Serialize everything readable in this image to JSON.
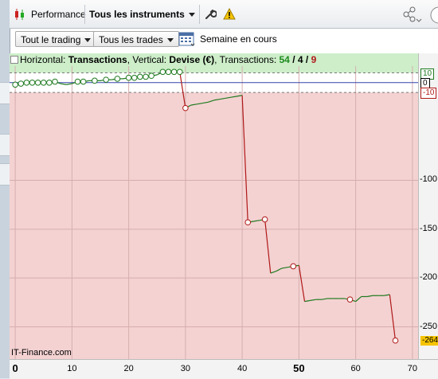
{
  "titlebar": {
    "performance_label": "Performance",
    "instruments_label": "Tous les instruments"
  },
  "toolbar": {
    "trading_label": "Tout le trading",
    "trades_label": "Tous les trades",
    "week_label": "Semaine en cours"
  },
  "infobar": {
    "horizontal_prefix": "Horizontal: ",
    "horizontal_value": "Transactions",
    "vertical_prefix": ", Vertical: ",
    "vertical_value": "Devise (€)",
    "count_prefix": ", Transactions: ",
    "count_total": "54",
    "sep1": " / ",
    "count_win": "4",
    "sep2": " / ",
    "count_loss": "9"
  },
  "watermark": "IT-Finance.com",
  "colors": {
    "profit_zone": "#cdeec9",
    "loss_zone": "#f4d2d2",
    "win_line": "#1e7a1e",
    "loss_line": "#b01818",
    "zero_line": "#3344aa",
    "last_value_badge": "#f5c400"
  },
  "chart_data": {
    "type": "line",
    "xlabel": "",
    "ylabel": "",
    "xlim": [
      -1,
      71
    ],
    "ylim": [
      -283,
      30
    ],
    "x_ticks": [
      0,
      10,
      20,
      30,
      40,
      50,
      60,
      70
    ],
    "x_bold_ticks": [
      0,
      50
    ],
    "y_ticks": [
      -100,
      -150,
      -200,
      -250
    ],
    "reference_lines": [
      10,
      0,
      -10
    ],
    "reference_labels": [
      "10",
      "0",
      "-10"
    ],
    "last_value_label": "-264",
    "series": [
      {
        "x": [
          0,
          1,
          2,
          3,
          4,
          5,
          6,
          7,
          8,
          9,
          10,
          11,
          12,
          13,
          14,
          15,
          16,
          17,
          18,
          19,
          20,
          21,
          22,
          23,
          24,
          25,
          26,
          27,
          28,
          29,
          30,
          31,
          32,
          33,
          34,
          35,
          36,
          37,
          38,
          39,
          40,
          41,
          42,
          43,
          44,
          45,
          46,
          47,
          48,
          49,
          50,
          51,
          52,
          53,
          54,
          55,
          56,
          57,
          58,
          59,
          60,
          61,
          62,
          63,
          64,
          65,
          66,
          67
        ],
        "y": [
          -2,
          -1,
          0,
          0,
          0,
          0,
          0,
          1,
          -1,
          -2,
          -1,
          1,
          1,
          2,
          2,
          2,
          3,
          3,
          4,
          4,
          5,
          5,
          6,
          6,
          7,
          8,
          11,
          11,
          11,
          11,
          -26,
          -23,
          -22,
          -21,
          -20,
          -18,
          -17,
          -16,
          -15,
          -14,
          -13,
          -143,
          -142,
          -141,
          -140,
          -195,
          -193,
          -190,
          -189,
          -188,
          -187,
          -224,
          -223,
          -222,
          -222,
          -221,
          -221,
          -221,
          -221,
          -222,
          -224,
          -219,
          -219,
          -218,
          -218,
          -218,
          -217,
          -264
        ],
        "markers": [
          0,
          1,
          2,
          3,
          4,
          5,
          6,
          7,
          11,
          12,
          14,
          16,
          18,
          20,
          21,
          22,
          23,
          24,
          26,
          27,
          28,
          29,
          30,
          41,
          44,
          49,
          59,
          67
        ]
      }
    ]
  }
}
